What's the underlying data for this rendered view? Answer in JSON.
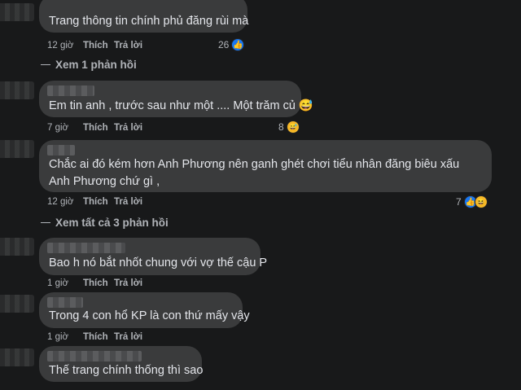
{
  "comments": [
    {
      "text": "Trang thông tin chính phủ đăng rùi mà",
      "time": "12 giờ",
      "like": "Thích",
      "reply": "Trả lời",
      "count": "26",
      "reactions": [
        "like-icon"
      ]
    },
    {
      "text": "Em tin anh , trước sau như một .... Một trăm củ 😅",
      "time": "7 giờ",
      "like": "Thích",
      "reply": "Trả lời",
      "count": "8",
      "reactions": [
        "laughing-sweat-icon"
      ]
    },
    {
      "text": "Chắc ai đó kém hơn Anh Phương nên ganh ghét chơi tiểu nhân đăng biêu xấu Anh Phương chứ gì ,",
      "time": "12 giờ",
      "like": "Thích",
      "reply": "Trả lời",
      "count": "7",
      "reactions": [
        "like-icon",
        "haha-icon"
      ]
    },
    {
      "text": "Bao h nó bắt nhốt chung với vợ thế cậu P",
      "time": "1 giờ",
      "like": "Thích",
      "reply": "Trả lời"
    },
    {
      "text": "Trong 4 con hổ KP là con thứ mấy vậy",
      "time": "1 giờ",
      "like": "Thích",
      "reply": "Trả lời"
    },
    {
      "text": "Thế trang chính thống thì sao"
    }
  ],
  "view_replies": [
    "Xem 1 phản hồi",
    "Xem tất cả 3 phản hồi"
  ],
  "icons": {
    "like": "👍",
    "haha": "😆",
    "sweat": "😅"
  }
}
